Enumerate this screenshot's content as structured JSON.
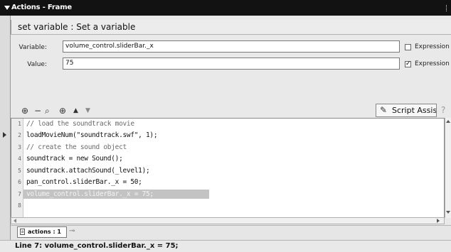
{
  "window": {
    "title": "Actions - Frame"
  },
  "header": {
    "title": "set variable : Set a variable"
  },
  "form": {
    "variable_label": "Variable:",
    "variable_value": "volume_control.sliderBar._x",
    "variable_expression_label": "Expression",
    "variable_expression_checked": false,
    "value_label": "Value:",
    "value_value": "75",
    "value_expression_label": "Expression",
    "value_expression_checked": true
  },
  "toolbar": {
    "icons": [
      "add-icon",
      "remove-icon",
      "find-icon",
      "target-icon",
      "move-up-icon",
      "move-down-icon"
    ],
    "script_assist_label": "Script Assis"
  },
  "editor": {
    "selected_line": 7,
    "lines": [
      {
        "num": "1",
        "text": "// load the soundtrack movie"
      },
      {
        "num": "2",
        "text": "loadMovieNum(\"soundtrack.swf\", 1);"
      },
      {
        "num": "3",
        "text": "// create the sound object"
      },
      {
        "num": "4",
        "text": "soundtrack = new Sound();"
      },
      {
        "num": "5",
        "text": "soundtrack.attachSound(_level1);"
      },
      {
        "num": "6",
        "text": "pan_control.sliderBar._x = 50;"
      },
      {
        "num": "7",
        "text": "volume_control.sliderBar._x = 75;"
      },
      {
        "num": "8",
        "text": ""
      }
    ]
  },
  "tabs": [
    {
      "label": "actions : 1"
    }
  ],
  "status": {
    "text": "Line 7: volume_control.sliderBar._x = 75;"
  },
  "colors": {
    "titlebar": "#121212",
    "panel": "#e9e9e9",
    "selection": "#c3c3c3"
  }
}
